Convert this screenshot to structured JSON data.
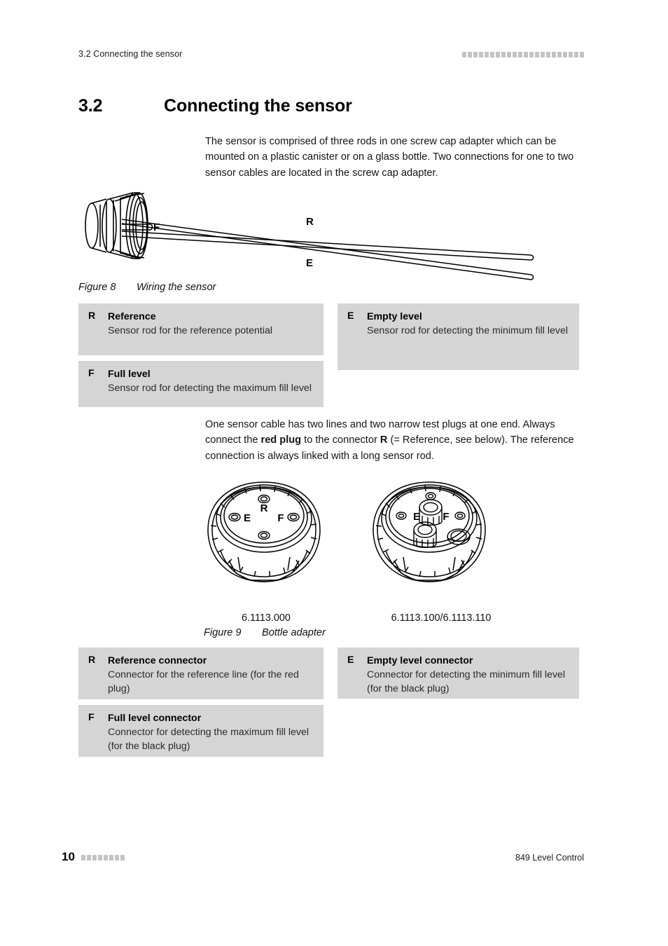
{
  "header": {
    "left_text": "3.2 Connecting the sensor",
    "square_count": 22,
    "square_color": "#c3c3c3"
  },
  "section": {
    "number": "3.2",
    "title": "Connecting the sensor"
  },
  "paragraphs": {
    "intro": "The sensor is comprised of three rods in one screw cap adapter which can be mounted on a plastic canister or on a glass bottle. Two connections for one to two sensor cables are located in the screw cap adapter.",
    "cable_prefix": "One sensor cable has two lines and two narrow test plugs at one end. Always connect the ",
    "cable_bold1": "red plug",
    "cable_mid": " to the connector ",
    "cable_bold2": "R",
    "cable_suffix": " (= Reference, see below). The reference connection is always linked with a long sensor rod."
  },
  "figure8": {
    "caption_label": "Figure 8",
    "caption_text": "Wiring the sensor",
    "rod_labels": {
      "full": "F",
      "reference": "R",
      "empty": "E"
    }
  },
  "figure9": {
    "caption_label": "Figure 9",
    "caption_text": "Bottle adapter",
    "left_part_number": "6.1113.000",
    "right_part_number": "6.1113.100/6.1113.110",
    "port_labels": {
      "reference": "R",
      "empty": "E",
      "full": "F"
    }
  },
  "legend_sensor": [
    {
      "key": "R",
      "title": "Reference",
      "desc": "Sensor rod for the reference potential"
    },
    {
      "key": "E",
      "title": "Empty level",
      "desc": "Sensor rod for detecting the minimum fill level"
    },
    {
      "key": "F",
      "title": "Full level",
      "desc": "Sensor rod for detecting the maximum fill level"
    }
  ],
  "legend_connector": [
    {
      "key": "R",
      "title": "Reference connector",
      "desc": "Connector for the reference line (for the red plug)"
    },
    {
      "key": "E",
      "title": "Empty level connector",
      "desc": "Connector for detecting the minimum fill level (for the black plug)"
    },
    {
      "key": "F",
      "title": "Full level connector",
      "desc": "Connector for detecting the maximum fill level (for the black plug)"
    }
  ],
  "footer": {
    "page_number": "10",
    "square_count": 8,
    "right_text": "849 Level Control"
  },
  "colors": {
    "legend_background": "#d5d5d5",
    "square_marker": "#c3c3c3",
    "text": "#141414"
  }
}
